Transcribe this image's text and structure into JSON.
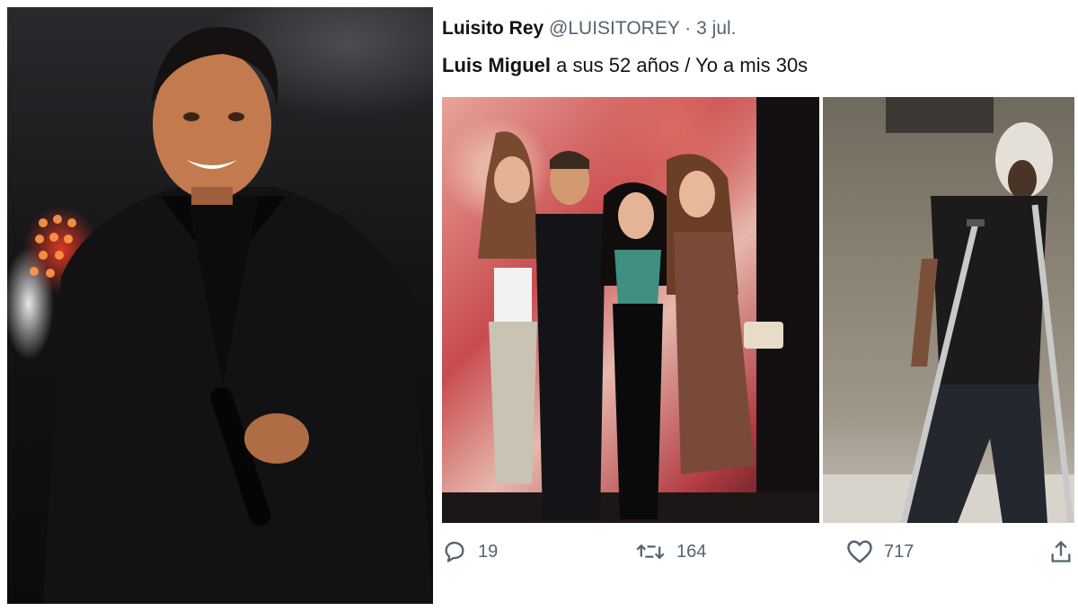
{
  "tweet": {
    "display_name": "Luisito Rey",
    "handle": "@LUISITOREY",
    "separator": "·",
    "date": "3 jul.",
    "text_bold": "Luis Miguel",
    "text_rest": " a sus 52 años / Yo a mis 30s"
  },
  "actions": {
    "replies": "19",
    "retweets": "164",
    "likes": "717"
  },
  "icons": {
    "reply": "reply-icon",
    "retweet": "retweet-icon",
    "like": "heart-icon",
    "share": "share-icon"
  },
  "colors": {
    "text_primary": "#0f1419",
    "text_secondary": "#536471"
  }
}
